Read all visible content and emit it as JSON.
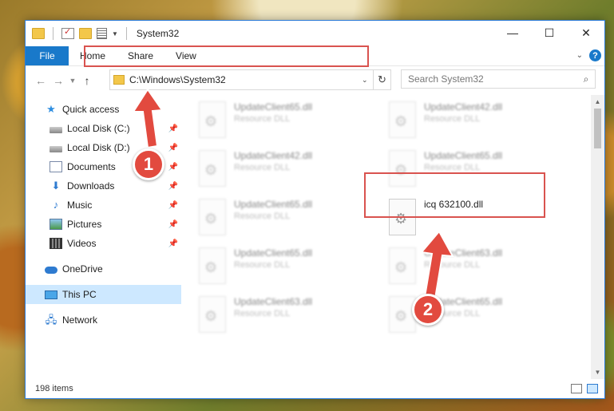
{
  "window": {
    "title": "System32",
    "controls": {
      "minimize": "—",
      "maximize": "☐",
      "close": "✕"
    }
  },
  "ribbon": {
    "file": "File",
    "tabs": [
      "Home",
      "Share",
      "View"
    ],
    "help": "?"
  },
  "nav": {
    "address": "C:\\Windows\\System32",
    "search_placeholder": "Search System32"
  },
  "sidebar": {
    "items": [
      {
        "label": "Quick access",
        "icon": "star-icon",
        "level": "top",
        "pinned": false
      },
      {
        "label": "Local Disk (C:)",
        "icon": "disk-icon",
        "level": "sub",
        "pinned": true
      },
      {
        "label": "Local Disk (D:)",
        "icon": "disk-icon",
        "level": "sub",
        "pinned": true
      },
      {
        "label": "Documents",
        "icon": "documents-icon",
        "level": "sub",
        "pinned": true
      },
      {
        "label": "Downloads",
        "icon": "downloads-icon",
        "level": "sub",
        "pinned": true
      },
      {
        "label": "Music",
        "icon": "music-icon",
        "level": "sub",
        "pinned": true
      },
      {
        "label": "Pictures",
        "icon": "pictures-icon",
        "level": "sub",
        "pinned": true
      },
      {
        "label": "Videos",
        "icon": "videos-icon",
        "level": "sub",
        "pinned": true
      },
      {
        "label": "OneDrive",
        "icon": "onedrive-icon",
        "level": "top",
        "pinned": false
      },
      {
        "label": "This PC",
        "icon": "this-pc-icon",
        "level": "top",
        "pinned": false,
        "selected": true
      },
      {
        "label": "Network",
        "icon": "network-icon",
        "level": "top",
        "pinned": false
      }
    ]
  },
  "files": [
    {
      "name": "UpdateClient65.dll",
      "type": "Resource DLL",
      "blurred": true
    },
    {
      "name": "UpdateClient42.dll",
      "type": "Resource DLL",
      "blurred": true
    },
    {
      "name": "UpdateClient42.dll",
      "type": "Resource DLL",
      "blurred": true
    },
    {
      "name": "UpdateClient65.dll",
      "type": "Resource DLL",
      "blurred": true
    },
    {
      "name": "UpdateClient65.dll",
      "type": "Resource DLL",
      "blurred": true
    },
    {
      "name": "icq 632100.dll",
      "type": "",
      "blurred": false
    },
    {
      "name": "UpdateClient65.dll",
      "type": "Resource DLL",
      "blurred": true
    },
    {
      "name": "UpdateClient63.dll",
      "type": "Resource DLL",
      "blurred": true
    },
    {
      "name": "UpdateClient63.dll",
      "type": "Resource DLL",
      "blurred": true
    },
    {
      "name": "UpdateClient65.dll",
      "type": "Resource DLL",
      "blurred": true
    }
  ],
  "status": {
    "items": "198 items"
  },
  "callouts": [
    {
      "number": "1",
      "color": "#e24a3f"
    },
    {
      "number": "2",
      "color": "#e24a3f"
    }
  ]
}
